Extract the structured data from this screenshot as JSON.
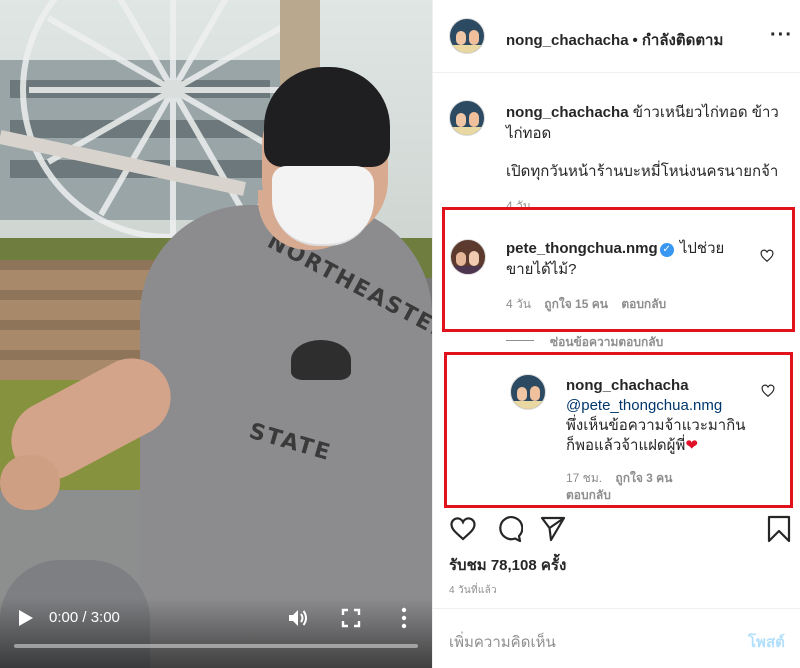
{
  "video": {
    "time": "0:00 / 3:00",
    "progress": 0.0,
    "shirt_print_top": "NORTHEASTERN",
    "shirt_print_bottom": "STATE"
  },
  "header": {
    "username": "nong_chachacha",
    "separator": "•",
    "follow_status": "กำลังติดตาม",
    "more": "···"
  },
  "caption": {
    "username": "nong_chachacha",
    "text_line1": "ข้าวเหนียวไก่ทอด ข้าว",
    "text_line2": "ไก่ทอด",
    "text_line3": "เปิดทุกวันหน้าร้านบะหมี่โหน่งนครนายกจ้า",
    "time": "4 วัน"
  },
  "comment": {
    "username": "pete_thongchua.nmg",
    "verified": "✓",
    "text_line1": "ไปช่วย",
    "text_line2": "ขายได้ไม้?",
    "time": "4 วัน",
    "likes": "ถูกใจ 15 คน",
    "reply": "ตอบกลับ",
    "hide_replies": "ซ่อนข้อความตอบกลับ"
  },
  "reply": {
    "username": "nong_chachacha",
    "mention": "@pete_thongchua.nmg",
    "text_line1": "พึ่งเห็นข้อความจ้าแวะมากิน",
    "text_line2": "ก็พอแล้วจ้าแฝดผู้พี่",
    "emoji": "❤",
    "time": "17 ชม.",
    "likes": "ถูกใจ 3 คน",
    "reply": "ตอบกลับ"
  },
  "actions": {
    "views": "รับชม 78,108 ครั้ง",
    "posted_ago": "4 วันที่แล้ว",
    "add_comment_placeholder": "เพิ่มความคิดเห็น",
    "post": "โพสต์"
  },
  "colors": {
    "highlight_box": "#e2121c",
    "link": "#00376b",
    "verified": "#3897f0",
    "post_disabled": "#b2dffc"
  }
}
